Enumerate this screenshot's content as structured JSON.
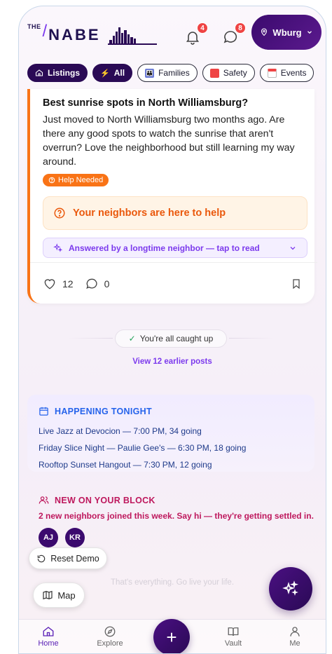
{
  "header": {
    "logo_the": "THE",
    "logo_slash": "/",
    "logo_nabe": "NABE",
    "notifications_count": "4",
    "messages_count": "8",
    "location_label": "Wburg"
  },
  "chips": [
    {
      "label": "Listings",
      "icon": "home-icon"
    },
    {
      "label": "All",
      "icon": "bolt-icon"
    },
    {
      "label": "Families",
      "icon": "family-icon"
    },
    {
      "label": "Safety",
      "icon": "siren-icon"
    },
    {
      "label": "Events",
      "icon": "calendar-icon"
    }
  ],
  "post": {
    "title": "Best sunrise spots in North Williamsburg?",
    "body": "Just moved to North Williamsburg two months ago. Are there any good spots to watch the sunrise that aren't overrun? Love the neighborhood but still learning my way around.",
    "tag": "Help Needed",
    "help_text": "Your neighbors are here to help",
    "answered_text": "Answered by a longtime neighbor — tap to read",
    "likes": "12",
    "comments": "0"
  },
  "feed": {
    "caught_up": "You're all caught up",
    "earlier_posts": "View 12 earlier posts"
  },
  "tonight": {
    "heading": "HAPPENING TONIGHT",
    "items": [
      "Live Jazz at Devocion — 7:00 PM, 34 going",
      "Friday Slice Night — Paulie Gee's — 6:30 PM, 18 going",
      "Rooftop Sunset Hangout — 7:30 PM, 12 going"
    ]
  },
  "block": {
    "heading": "NEW ON YOUR BLOCK",
    "text": "2 new neighbors joined this week. Say hi — they're getting settled in.",
    "avatars": [
      "AJ",
      "KR"
    ]
  },
  "controls": {
    "reset": "Reset Demo",
    "map": "Map",
    "footer_text": "That's everything. Go live your life."
  },
  "nav": {
    "items": [
      {
        "label": "Home",
        "icon": "home-icon"
      },
      {
        "label": "Explore",
        "icon": "compass-icon"
      },
      {
        "label": "Vault",
        "icon": "book-icon"
      },
      {
        "label": "Me",
        "icon": "user-icon"
      }
    ],
    "plus": "+"
  },
  "colors": {
    "brand_dark": "#2a0a55",
    "accent_purple": "#7c3aed",
    "help_orange": "#f97316",
    "tonight_blue": "#2563eb",
    "block_pink": "#be185d"
  }
}
